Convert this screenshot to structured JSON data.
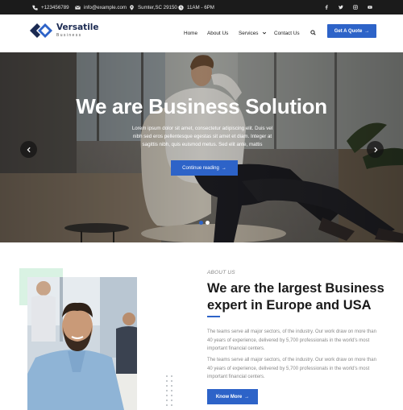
{
  "topbar": {
    "phone": "+123456789",
    "email": "info@example.com",
    "location": "Sumter,SC 29150",
    "hours": "11AM - 6PM",
    "social": [
      "facebook-icon",
      "twitter-icon",
      "instagram-icon",
      "youtube-icon"
    ]
  },
  "header": {
    "logo_name": "Versatile",
    "logo_sub": "Business",
    "nav": [
      "Home",
      "About Us",
      "Services",
      "Contact Us"
    ],
    "cta": "Get A Quote"
  },
  "hero": {
    "title": "We are Business Solution",
    "text": "Lorem ipsum dolor sit amet, consectetur adipiscing elit. Duis vel nibh sed eros pellentesque egestas sit amet et diam. Integer at sagittis nibh, quis euismod metus. Sed elit ante, mattis",
    "button": "Continue reading",
    "active_slide": 1,
    "slide_count": 2
  },
  "about": {
    "tag": "ABOUT US",
    "title": "We are the largest Business expert in Europe and USA",
    "p1": "The teams serve all major sectors, of the industry. Our work draw on more than 40 years of experience, delivered by 5,700 professionals in the world's most important financial centers.",
    "p2": "The teams serve all major sectors, of the industry. Our work draw on more than 40 years of experience, delivered by 5,700 professionals in the world's most important financial centers.",
    "button": "Know More"
  },
  "colors": {
    "accent": "#2d63c8",
    "topbar": "#1b1b1b",
    "logo": "#1b2a52"
  }
}
